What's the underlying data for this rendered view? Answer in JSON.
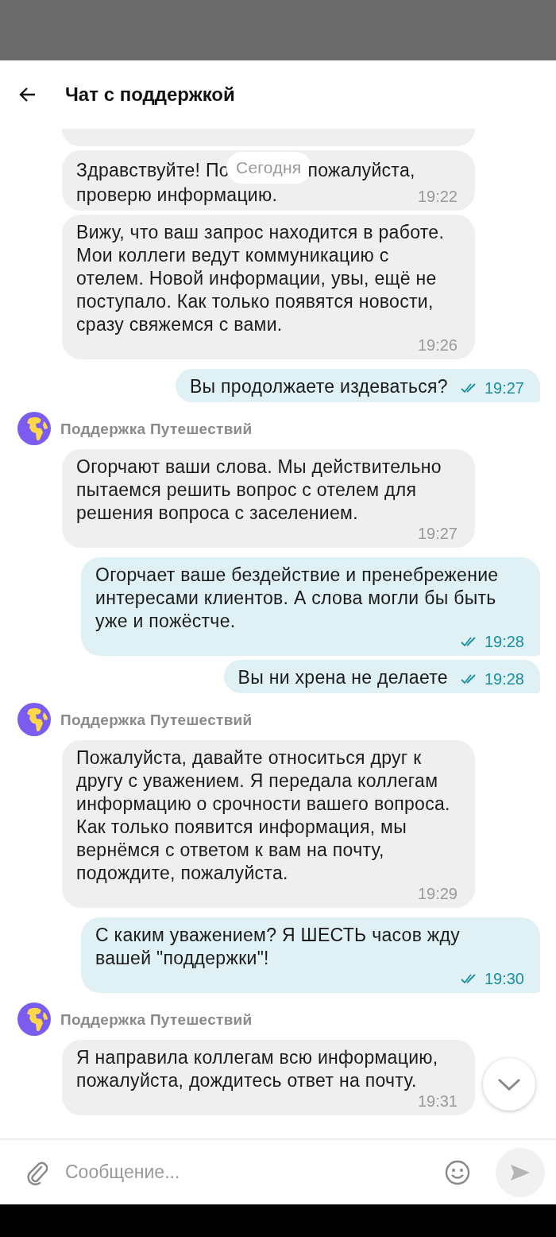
{
  "header": {
    "title": "Чат с поддержкой"
  },
  "messages": [
    {
      "kind": "cut"
    },
    {
      "kind": "incoming",
      "covered_line": {
        "before": "Здравствуйте! По",
        "after": "пожалуйста,"
      },
      "date_label": "Сегодня",
      "text": "проверю информацию.",
      "time": "19:22"
    },
    {
      "kind": "incoming",
      "text": "Вижу, что ваш запрос находится в работе. Мои коллеги ведут коммуникацию с отелем. Новой информации, увы, ещё не поступало. Как только появятся новости, сразу свяжемся с вами.",
      "time": "19:26"
    },
    {
      "kind": "outgoing",
      "text": "Вы продолжаете издеваться?",
      "time": "19:27",
      "read": true
    },
    {
      "kind": "sender",
      "name": "Поддержка Путешествий"
    },
    {
      "kind": "incoming",
      "text": "Огорчают ваши слова. Мы действительно пытаемся решить вопрос с отелем для решения вопроса с заселением.",
      "time": "19:27"
    },
    {
      "kind": "outgoing",
      "text": "Огорчает ваше бездействие и пренебрежение интересами клиентов. А слова могли бы быть уже и пожёстче.",
      "time": "19:28",
      "read": true
    },
    {
      "kind": "outgoing",
      "text": "Вы ни хрена не делаете",
      "time": "19:28",
      "read": true
    },
    {
      "kind": "sender",
      "name": "Поддержка Путешествий"
    },
    {
      "kind": "incoming",
      "text": "Пожалуйста, давайте относиться друг к другу с уважением. Я передала коллегам информацию о срочности вашего вопроса. Как только появится информация, мы вернёмся с ответом к вам на почту, подождите, пожалуйста.",
      "time": "19:29"
    },
    {
      "kind": "outgoing",
      "text": "С каким уважением? Я ШЕСТЬ часов жду вашей \"поддержки\"!",
      "time": "19:30",
      "read": true
    },
    {
      "kind": "sender",
      "name": "Поддержка Путешествий"
    },
    {
      "kind": "incoming",
      "text": "Я направила коллегам всю информацию, пожалуйста, дождитесь ответ на почту.",
      "time": "19:31"
    }
  ],
  "composer": {
    "placeholder": "Сообщение..."
  }
}
